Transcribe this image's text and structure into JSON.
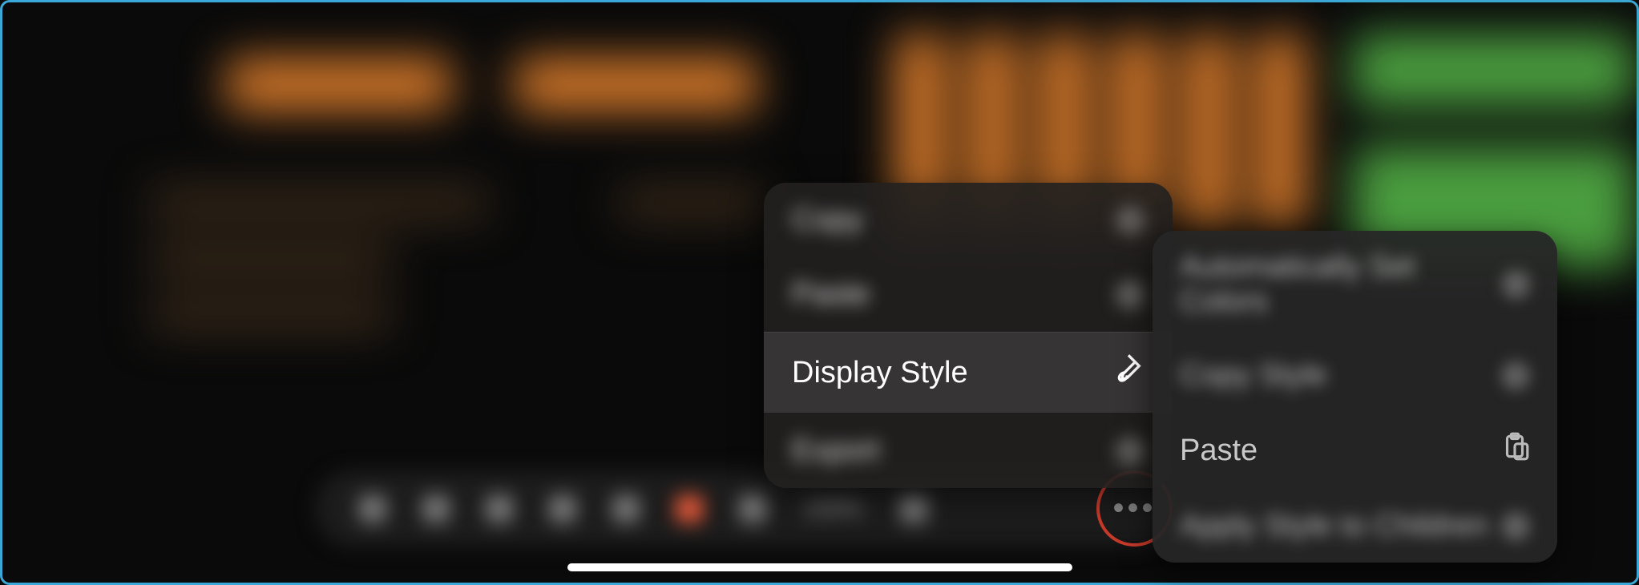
{
  "toolbar": {
    "zoom_label": "100%"
  },
  "popup1": {
    "items": [
      {
        "label": "Copy"
      },
      {
        "label": "Paste"
      },
      {
        "label": "Display Style"
      },
      {
        "label": "Export"
      }
    ]
  },
  "popup2": {
    "items": [
      {
        "label": "Automatically Set Colors"
      },
      {
        "label": "Copy Style"
      },
      {
        "label": "Paste"
      },
      {
        "label": "Apply Style to Children"
      }
    ]
  }
}
